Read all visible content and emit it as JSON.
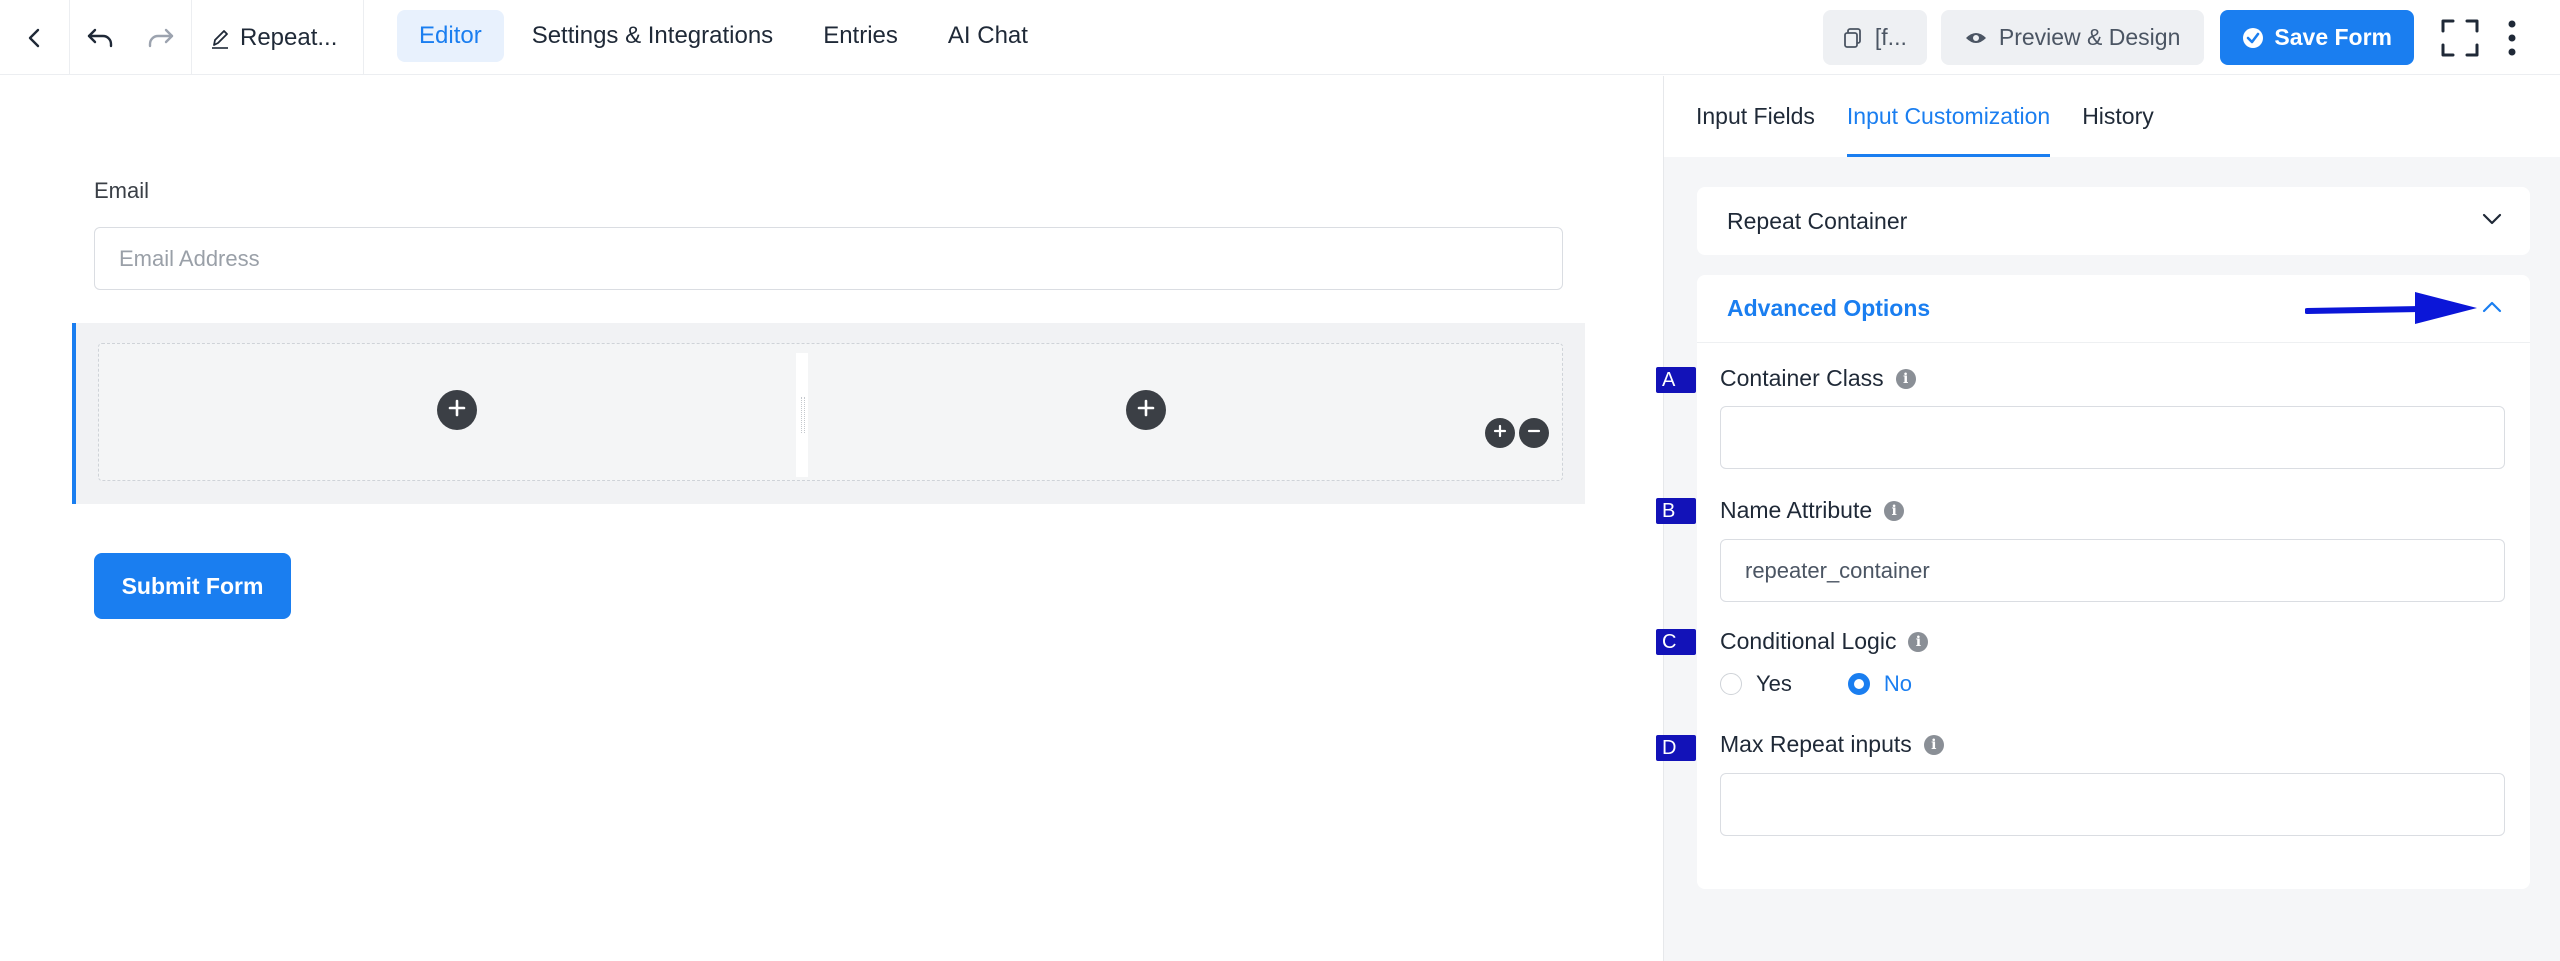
{
  "topbar": {
    "title": "Repeat...",
    "nav": [
      "Editor",
      "Settings & Integrations",
      "Entries",
      "AI Chat"
    ],
    "shortcode_label": "[f...",
    "preview_label": "Preview & Design",
    "save_label": "Save Form"
  },
  "canvas": {
    "email_label": "Email",
    "email_placeholder": "Email Address",
    "submit_label": "Submit Form"
  },
  "sidebar": {
    "tabs": [
      "Input Fields",
      "Input Customization",
      "History"
    ],
    "panel_repeat": "Repeat Container",
    "panel_advanced": "Advanced Options",
    "fields": {
      "container_class": {
        "label": "Container Class",
        "value": ""
      },
      "name_attribute": {
        "label": "Name Attribute",
        "value": "repeater_container"
      },
      "conditional_logic": {
        "label": "Conditional Logic",
        "options": [
          "Yes",
          "No"
        ],
        "selected": "No"
      },
      "max_repeat": {
        "label": "Max Repeat inputs",
        "value": ""
      }
    },
    "markers": [
      "A",
      "B",
      "C",
      "D"
    ]
  },
  "colors": {
    "accent": "#1a7ef0",
    "marker": "#1212b8",
    "arrow": "#0b16d8"
  }
}
